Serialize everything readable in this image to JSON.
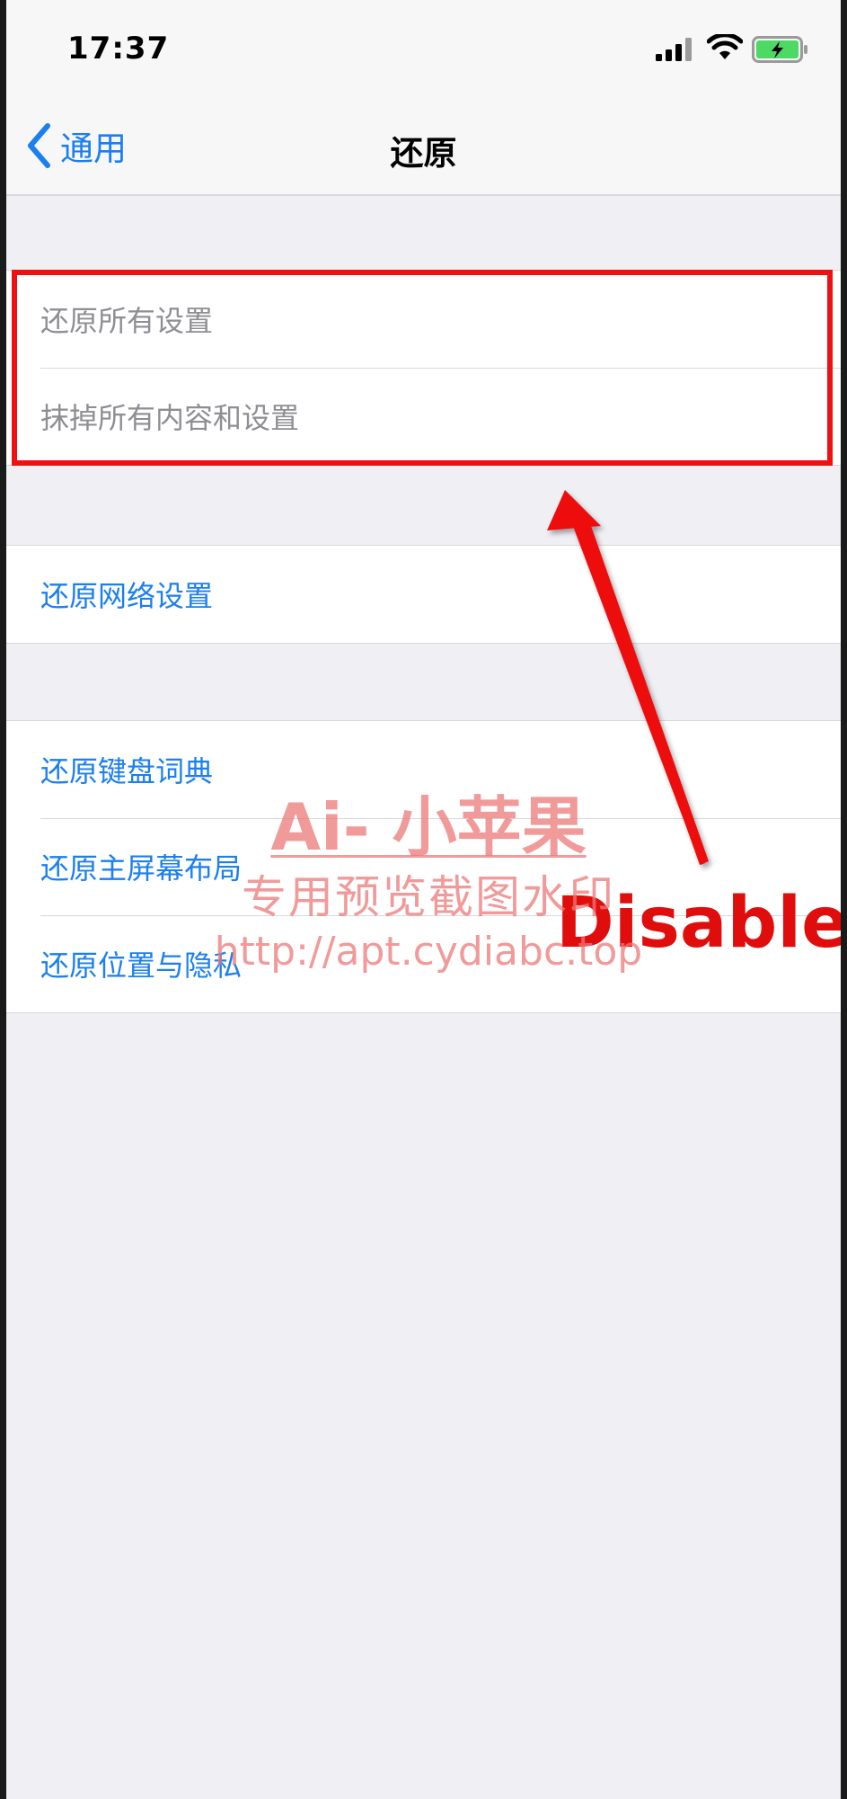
{
  "status_bar": {
    "time": "17:37"
  },
  "nav": {
    "back_label": "通用",
    "title": "还原"
  },
  "groups": [
    {
      "rows": [
        {
          "label": "还原所有设置",
          "state": "disabled"
        },
        {
          "label": "抹掉所有内容和设置",
          "state": "disabled"
        }
      ]
    },
    {
      "rows": [
        {
          "label": "还原网络设置",
          "state": "active"
        }
      ]
    },
    {
      "rows": [
        {
          "label": "还原键盘词典",
          "state": "active"
        },
        {
          "label": "还原主屏幕布局",
          "state": "active"
        },
        {
          "label": "还原位置与隐私",
          "state": "active"
        }
      ]
    }
  ],
  "annotation": {
    "label": "Disable",
    "color": "#e00d0d"
  },
  "watermark": {
    "line1": "Ai- 小苹果",
    "line2": "专用预览截图水印",
    "line3": "http://apt.cydiabc.top"
  },
  "colors": {
    "accent": "#1a7ff0",
    "disabled_text": "#8e8e93",
    "background": "#efeff4",
    "battery": "#4cd964"
  },
  "icons": {
    "back": "chevron-left-icon",
    "signal": "cellular-signal-icon",
    "wifi": "wifi-icon",
    "battery": "battery-charging-icon"
  }
}
